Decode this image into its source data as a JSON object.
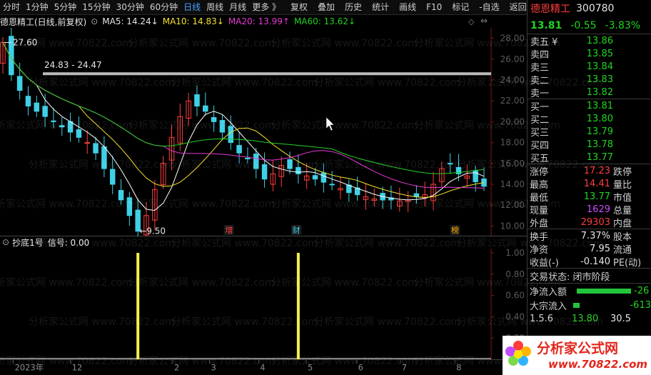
{
  "toolbar": {
    "items": [
      "分时",
      "1分钟",
      "5分钟",
      "15分钟",
      "30分钟",
      "60分钟",
      "日线",
      "周线",
      "月线",
      "更多 》",
      "复权",
      "叠加",
      "历史",
      "统计",
      "画线",
      "F10",
      "标记",
      "-自选",
      "返回"
    ],
    "active": "日线"
  },
  "chart_header": {
    "stock_name": "德恩精工(日线,前复权)",
    "ma5": "MA5: 14.24↓",
    "ma10": "MA10: 14.83↓",
    "ma20": "MA20: 13.99↑",
    "ma60": "MA60: 13.62↓"
  },
  "main_chart": {
    "y_ticks": [
      "28.00",
      "26.00",
      "24.00",
      "22.00",
      "20.00",
      "18.00",
      "16.00",
      "14.00",
      "12.00",
      "10.00"
    ],
    "high_label": "27.60",
    "low_label": "←9.50",
    "range_label": "24.83 - 24.47",
    "markers": [
      "增",
      "财",
      "榜"
    ]
  },
  "sub_chart": {
    "title": "抄底1号",
    "signal": "信号: 0.00",
    "y_ticks": [
      "1.00",
      "0.80",
      "0.60",
      "0.40",
      "0.20"
    ]
  },
  "x_axis": {
    "labels": [
      "2023年",
      "12",
      "2",
      "3",
      "4",
      "5",
      "6",
      "7",
      "8"
    ]
  },
  "quote": {
    "name": "德恩精工",
    "code": "300780",
    "price": "13.81",
    "change": "-0.55",
    "pct": "-3.83%",
    "asks": [
      {
        "label": "卖五 ¥",
        "price": "13.86"
      },
      {
        "label": "卖四",
        "price": "13.85"
      },
      {
        "label": "卖三",
        "price": "13.84"
      },
      {
        "label": "卖二",
        "price": "13.83"
      },
      {
        "label": "卖一",
        "price": "13.82"
      }
    ],
    "bids": [
      {
        "label": "买一",
        "price": "13.81"
      },
      {
        "label": "买二",
        "price": "13.80"
      },
      {
        "label": "买三",
        "price": "13.79"
      },
      {
        "label": "买四",
        "price": "13.78"
      },
      {
        "label": "买五",
        "price": "13.77"
      }
    ],
    "stats": [
      {
        "l": "涨停",
        "v": "17.23",
        "r": "跌停",
        "c": "red"
      },
      {
        "l": "最高",
        "v": "14.41",
        "r": "量比",
        "c": "red"
      },
      {
        "l": "最低",
        "v": "13.77",
        "r": "市值",
        "c": "green"
      },
      {
        "l": "现量",
        "v": "1629",
        "r": "总量",
        "c": "purple"
      },
      {
        "l": "外盘",
        "v": "29303",
        "r": "内盘",
        "c": "red"
      }
    ],
    "stats2": [
      {
        "l": "换手",
        "v": "7.37%",
        "r": "股本"
      },
      {
        "l": "净资",
        "v": "7.95",
        "r": "流通"
      },
      {
        "l": "收益(-)",
        "v": "-0.140",
        "r": "PE(动)"
      }
    ],
    "trade_status": "交易状态: 闭市阶段",
    "flows": [
      {
        "label": "净流入额",
        "value": "-26"
      },
      {
        "label": "大宗流入",
        "value": "-613"
      }
    ],
    "partial_row": {
      "a": "1.5.6",
      "b": "13.80",
      "c": "30.5"
    }
  },
  "watermark": "分析家公式网 www.70822.com",
  "logo": {
    "text": "分析家公式网",
    "url": "www.70822.com"
  },
  "colors": {
    "up": "#ff3d3d",
    "down": "#22d322",
    "ma5": "#ffffff",
    "ma10": "#f5e12a",
    "ma20": "#e83bd8",
    "ma60": "#22d322",
    "signal": "#f5f04a"
  },
  "chart_data": {
    "type": "candlestick",
    "title": "德恩精工(日线,前复权)",
    "ylim": [
      9,
      29
    ],
    "close_approx": [
      27.6,
      24.5,
      23.0,
      21.5,
      21.0,
      20.5,
      20.0,
      19.5,
      19.0,
      18.5,
      18.0,
      17.0,
      15.5,
      14.0,
      12.5,
      11.0,
      9.5,
      11.0,
      13.5,
      16.0,
      18.5,
      20.5,
      22.0,
      21.5,
      21.0,
      20.0,
      19.0,
      18.0,
      17.0,
      16.5,
      15.5,
      14.5,
      15.0,
      15.8,
      15.5,
      15.0,
      14.8,
      14.5,
      14.2,
      14.0,
      13.6,
      13.2,
      13.0,
      12.8,
      12.6,
      12.5,
      12.5,
      12.4,
      12.5,
      12.8,
      13.0,
      14.0,
      15.5,
      16.0,
      15.0,
      14.8,
      14.24,
      13.81
    ],
    "signals_x_index": [
      16,
      35
    ]
  }
}
